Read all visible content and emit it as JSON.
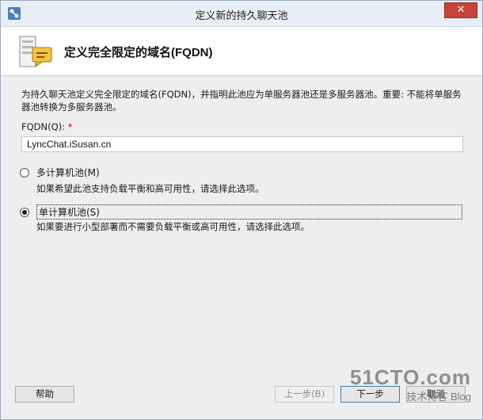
{
  "window": {
    "title": "定义新的持久聊天池",
    "close_label": "✕"
  },
  "header": {
    "title": "定义完全限定的域名(FQDN)"
  },
  "description": "为持久聊天池定义完全限定的域名(FQDN)，并指明此池应为单服务器池还是多服务器池。重要: 不能将单服务器池转换为多服务器池。",
  "fqdn": {
    "label": "FQDN(Q):",
    "required_mark": "*",
    "value": "LyncChat.iSusan.cn"
  },
  "options": [
    {
      "label": "多计算机池(M)",
      "description": "如果希望此池支持负载平衡和高可用性，请选择此选项。",
      "selected": false
    },
    {
      "label": "单计算机池(S)",
      "description": "如果要进行小型部署而不需要负载平衡或高可用性，请选择此选项。",
      "selected": true
    }
  ],
  "buttons": {
    "help": "帮助",
    "back": "上一步(B)",
    "next": "下一步",
    "cancel": "取消"
  },
  "watermark": {
    "main": "51CTO.com",
    "sub": "技术博客 Blog"
  }
}
